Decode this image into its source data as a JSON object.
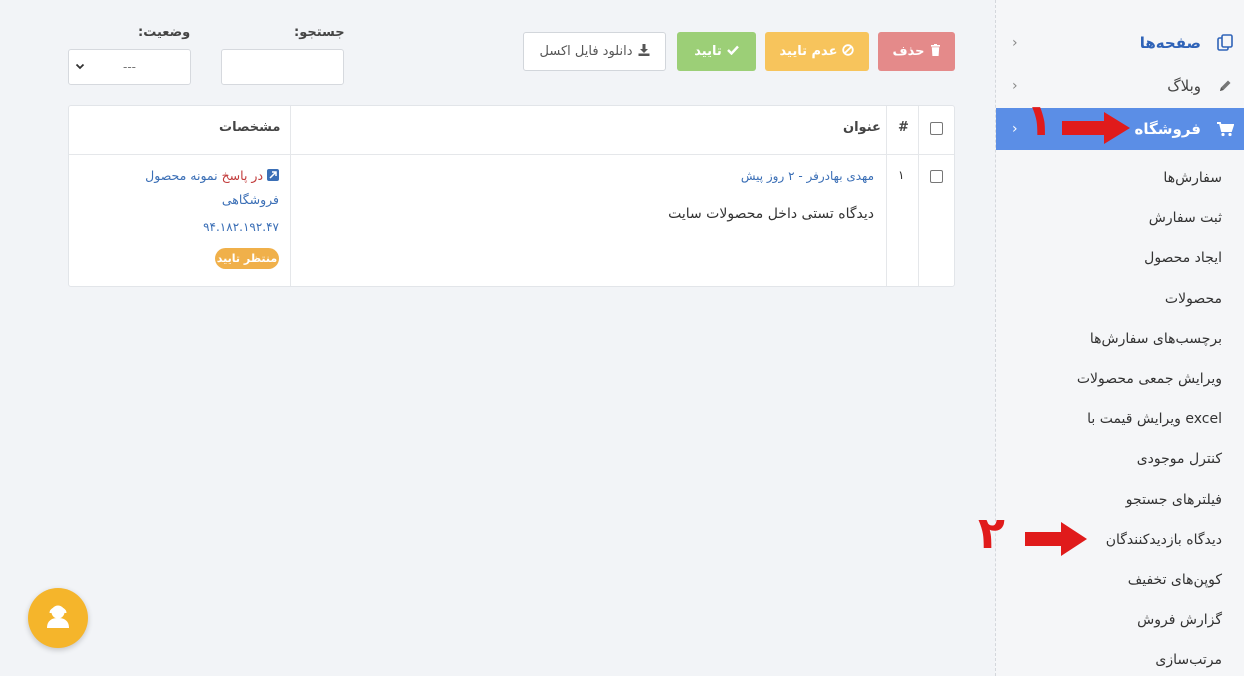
{
  "sidebar": {
    "pages_label": "صفحه‌ها",
    "blog_label": "وبلاگ",
    "shop_label": "فروشگاه",
    "items": [
      {
        "label": "سفارش‌ها"
      },
      {
        "label": "ثبت سفارش"
      },
      {
        "label": "ایجاد محصول"
      },
      {
        "label": "محصولات"
      },
      {
        "label": "برچسب‌های سفارش‌ها"
      },
      {
        "label": "ویرایش جمعی محصولات"
      },
      {
        "label": "ویرایش قیمت با excel"
      },
      {
        "label": "کنترل موجودی"
      },
      {
        "label": "فیلترهای جستجو"
      },
      {
        "label": "دیدگاه بازدیدکنندگان"
      },
      {
        "label": "کوپن‌های تخفیف"
      },
      {
        "label": "گزارش فروش"
      },
      {
        "label": "مرتب‌سازی"
      }
    ]
  },
  "annotations": {
    "one": "۱",
    "two": "۲"
  },
  "toolbar": {
    "delete_label": "حذف",
    "reject_label": "عدم تایید",
    "approve_label": "تایید",
    "excel_label": "دانلود فایل اکسل"
  },
  "filters": {
    "search_label": "جستجو:",
    "status_label": "وضعیت:",
    "status_value": "---"
  },
  "table": {
    "col_hash": "#",
    "col_title": "عنوان",
    "col_details": "مشخصات",
    "rows": [
      {
        "index": "۱",
        "author_line": "مهدی بهادرفر - ۲ روز پیش",
        "comment": "دیدگاه تستی داخل محصولات سایت",
        "reply_prefix": "در پاسخ",
        "product_line1": "نمونه محصول",
        "product_line2": "فروشگاهی",
        "ip": "۹۴.۱۸۲.۱۹۲.۴۷",
        "status": "منتظر تایید"
      }
    ]
  },
  "colors": {
    "active": "#5b8ee6",
    "delete": "#e48a8a",
    "reject": "#f7c45c",
    "approve": "#9ccf77",
    "badge": "#f0b04a"
  }
}
